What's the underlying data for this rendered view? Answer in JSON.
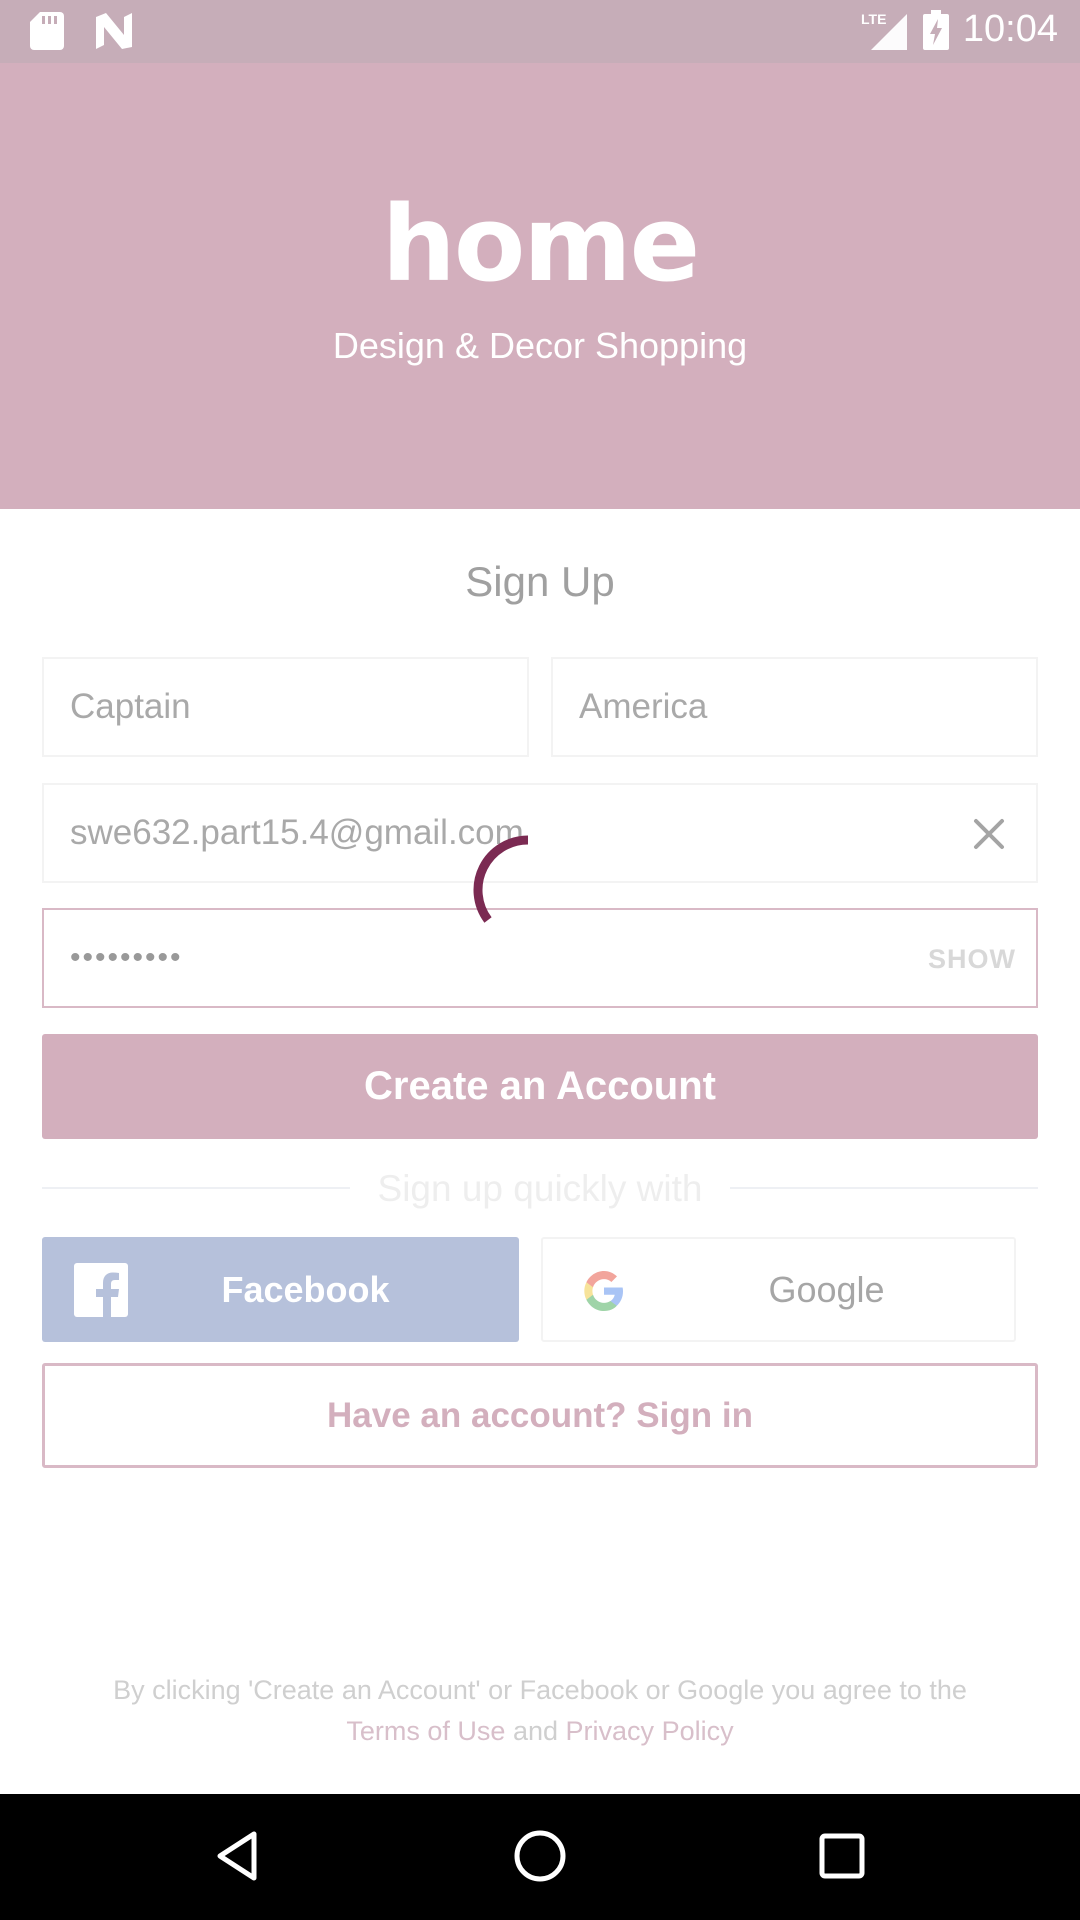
{
  "status_bar": {
    "time": "10:04",
    "network": "LTE",
    "icons": [
      "sd-card-icon",
      "n-notification-icon",
      "lte-signal-icon",
      "battery-charging-icon"
    ]
  },
  "hero": {
    "logo": "home",
    "tagline": "Design & Decor Shopping"
  },
  "form": {
    "title": "Sign Up",
    "first_name": "Captain",
    "last_name": "America",
    "email": "swe632.part15.4@gmail.com",
    "password_masked": "•••••••••",
    "show_label": "SHOW",
    "create_button": "Create an Account"
  },
  "social": {
    "divider_text": "Sign up quickly with",
    "facebook_label": "Facebook",
    "google_label": "Google"
  },
  "signin_label": "Have an account? Sign in",
  "legal": {
    "text": "By clicking 'Create an Account' or Facebook or Google you agree to the",
    "terms": "Terms of Use",
    "and": "and",
    "privacy": "Privacy Policy"
  },
  "colors": {
    "brand": "#d3afbd",
    "spinner": "#7b2a52",
    "facebook": "#b6c1db"
  }
}
